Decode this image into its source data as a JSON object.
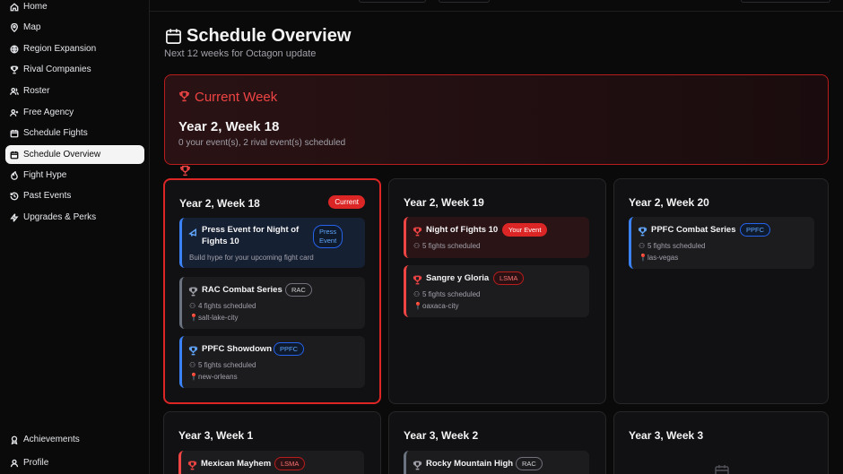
{
  "sidebar": {
    "items": [
      {
        "label": "Home",
        "icon": "home-icon"
      },
      {
        "label": "Map",
        "icon": "map-pin-icon"
      },
      {
        "label": "Region Expansion",
        "icon": "globe-icon"
      },
      {
        "label": "Rival Companies",
        "icon": "trophy-icon"
      },
      {
        "label": "Roster",
        "icon": "users-icon"
      },
      {
        "label": "Free Agency",
        "icon": "user-plus-icon"
      },
      {
        "label": "Schedule Fights",
        "icon": "calendar-icon"
      },
      {
        "label": "Schedule Overview",
        "icon": "calendar-icon"
      },
      {
        "label": "Fight Hype",
        "icon": "flame-icon"
      },
      {
        "label": "Past Events",
        "icon": "history-icon"
      },
      {
        "label": "Upgrades & Perks",
        "icon": "zap-icon"
      }
    ],
    "bottom": [
      {
        "label": "Achievements",
        "icon": "award-icon"
      },
      {
        "label": "Profile",
        "icon": "user-icon"
      }
    ],
    "active_index": 7
  },
  "header": {
    "title": "Schedule Overview",
    "subtitle": "Next 12 weeks for Octagon update"
  },
  "current_week": {
    "label": "Current Week",
    "week": "Year 2, Week 18",
    "summary": "0 your event(s), 2 rival event(s) scheduled"
  },
  "weeks": [
    {
      "title": "Year 2, Week 18",
      "badge": "Current",
      "events": [
        {
          "name_line1": "Press Event for Night of",
          "name_line2": "Fights 10",
          "tag_line1": "Press",
          "tag_line2": "Event",
          "desc": "Build hype for your upcoming fight card"
        },
        {
          "name": "RAC Combat Series",
          "tag": "RAC",
          "fights": "4 fights scheduled",
          "location": "salt-lake-city"
        },
        {
          "name": "PPFC Showdown",
          "tag": "PPFC",
          "fights": "5 fights scheduled",
          "location": "new-orleans"
        }
      ]
    },
    {
      "title": "Year 2, Week 19",
      "events": [
        {
          "name": "Night of Fights 10",
          "tag": "Your Event",
          "fights": "5 fights scheduled"
        },
        {
          "name": "Sangre y Gloria",
          "tag": "LSMA",
          "fights": "5 fights scheduled",
          "location": "oaxaca-city"
        }
      ]
    },
    {
      "title": "Year 2, Week 20",
      "events": [
        {
          "name": "PPFC Combat Series",
          "tag": "PPFC",
          "fights": "5 fights scheduled",
          "location": "las-vegas"
        }
      ]
    },
    {
      "title": "Year 3, Week 1",
      "events": [
        {
          "name": "Mexican Mayhem",
          "tag": "LSMA"
        }
      ]
    },
    {
      "title": "Year 3, Week 2",
      "events": [
        {
          "name": "Rocky Mountain High",
          "tag": "RAC"
        }
      ]
    },
    {
      "title": "Year 3, Week 3",
      "events": []
    }
  ],
  "colors": {
    "accent_red": "#dc2626",
    "accent_blue": "#3b82f6",
    "background": "#0a0a0a",
    "card": "#111113"
  }
}
